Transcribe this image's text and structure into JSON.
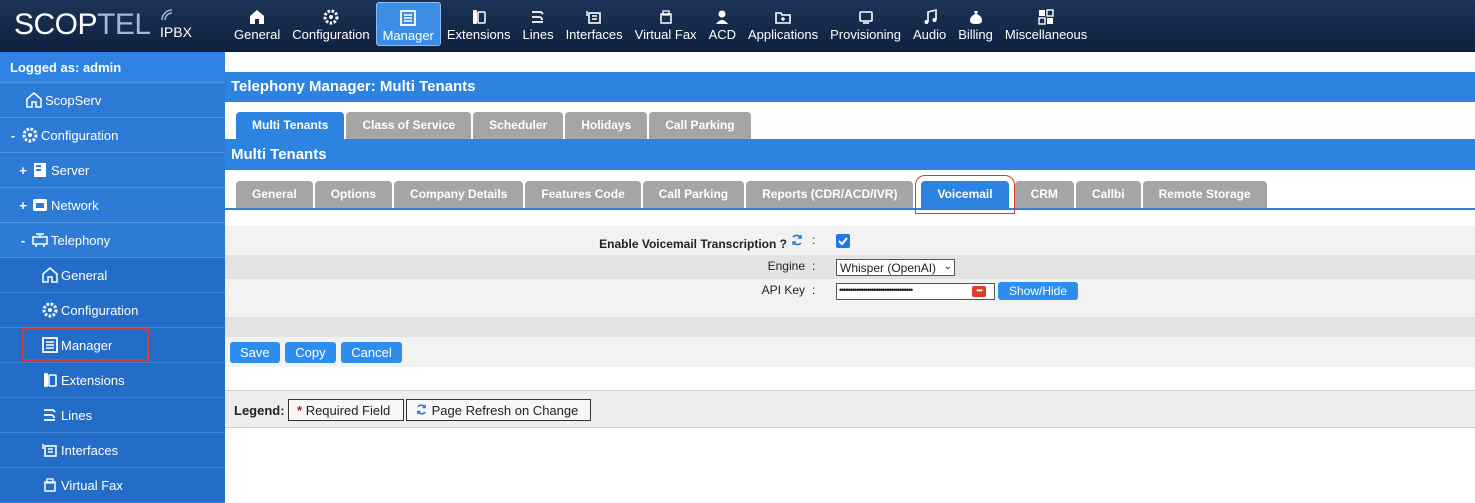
{
  "logo": {
    "brand_a": "SCOP",
    "brand_b": "TEL",
    "sub": "IPBX"
  },
  "topnav": [
    {
      "label": "General",
      "icon": "home-icon"
    },
    {
      "label": "Configuration",
      "icon": "gear-icon"
    },
    {
      "label": "Manager",
      "icon": "list-icon",
      "active": true
    },
    {
      "label": "Extensions",
      "icon": "phone-icon"
    },
    {
      "label": "Lines",
      "icon": "lines-icon"
    },
    {
      "label": "Interfaces",
      "icon": "interface-icon"
    },
    {
      "label": "Virtual Fax",
      "icon": "fax-icon"
    },
    {
      "label": "ACD",
      "icon": "agent-icon"
    },
    {
      "label": "Applications",
      "icon": "folder-icon"
    },
    {
      "label": "Provisioning",
      "icon": "provisioning-icon"
    },
    {
      "label": "Audio",
      "icon": "music-icon"
    },
    {
      "label": "Billing",
      "icon": "moneybag-icon"
    },
    {
      "label": "Miscellaneous",
      "icon": "grid-icon"
    }
  ],
  "sidebar": {
    "user": "Logged as: admin",
    "items": [
      {
        "toggle": "",
        "label": "ScopServ",
        "icon": "home-icon"
      },
      {
        "toggle": "-",
        "label": "Configuration",
        "icon": "gear-icon"
      },
      {
        "toggle": "+",
        "label": "Server",
        "icon": "server-icon"
      },
      {
        "toggle": "+",
        "label": "Network",
        "icon": "network-icon"
      },
      {
        "toggle": "-",
        "label": "Telephony",
        "icon": "telephony-icon"
      },
      {
        "toggle": "",
        "label": "General",
        "icon": "home-icon"
      },
      {
        "toggle": "",
        "label": "Configuration",
        "icon": "gear-icon"
      },
      {
        "toggle": "",
        "label": "Manager",
        "icon": "list-icon"
      },
      {
        "toggle": "",
        "label": "Extensions",
        "icon": "phone-icon"
      },
      {
        "toggle": "",
        "label": "Lines",
        "icon": "lines-icon"
      },
      {
        "toggle": "",
        "label": "Interfaces",
        "icon": "interface-icon"
      },
      {
        "toggle": "",
        "label": "Virtual Fax",
        "icon": "fax-icon"
      }
    ]
  },
  "page": {
    "title": "Telephony Manager:  Multi Tenants",
    "tabs": [
      "Multi Tenants",
      "Class of Service",
      "Scheduler",
      "Holidays",
      "Call Parking"
    ],
    "section_title": "Multi Tenants",
    "subtabs": [
      "General",
      "Options",
      "Company Details",
      "Features Code",
      "Call Parking",
      "Reports (CDR/ACD/IVR)",
      "Voicemail",
      "CRM",
      "Callbi",
      "Remote Storage"
    ]
  },
  "form": {
    "transcription_label": "Enable Voicemail Transcription ?",
    "transcription_checked": true,
    "engine_label": "Engine",
    "engine_value": "Whisper (OpenAI)",
    "apikey_label": "API Key",
    "apikey_masked": "••••••••••••••••••••••••••••••••••",
    "apikey_badge": "•••",
    "showhide": "Show/Hide",
    "colon": ":"
  },
  "actions": {
    "save": "Save",
    "copy": "Copy",
    "cancel": "Cancel"
  },
  "legend": {
    "title": "Legend:",
    "required": "Required Field",
    "required_mark": "*",
    "refresh": "Page Refresh on Change"
  },
  "colors": {
    "header": "#0f2140",
    "accent": "#2d83e0",
    "sidebar": "#2e7fdc",
    "highlight": "#d63a3a"
  }
}
